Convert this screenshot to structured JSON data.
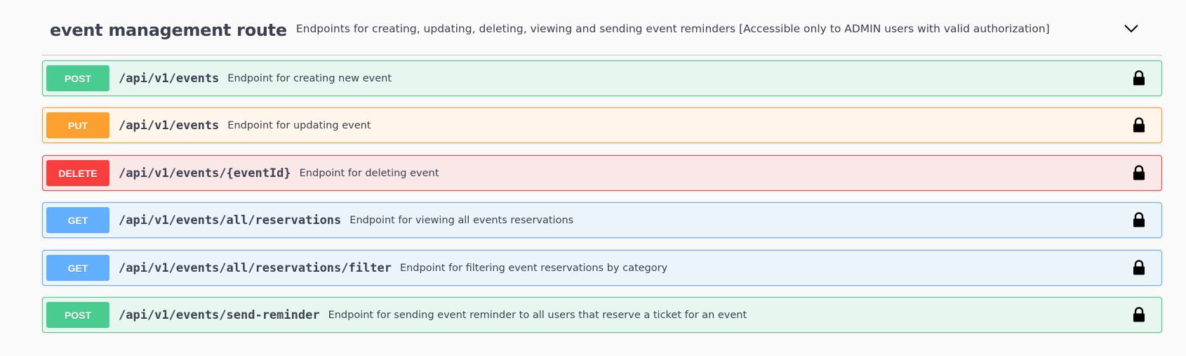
{
  "tag": {
    "name": "event management route",
    "description": "Endpoints for creating, updating, deleting, viewing and sending event reminders [Accessible only to ADMIN users with valid authorization]",
    "toggle_icon": "chevron-down-icon"
  },
  "operations": [
    {
      "method": "POST",
      "path": "/api/v1/events",
      "summary": "Endpoint for creating new event",
      "lock_icon": "lock-icon"
    },
    {
      "method": "PUT",
      "path": "/api/v1/events",
      "summary": "Endpoint for updating event",
      "lock_icon": "lock-icon"
    },
    {
      "method": "DELETE",
      "path": "/api/v1/events/{eventId}",
      "summary": "Endpoint for deleting event",
      "lock_icon": "lock-icon"
    },
    {
      "method": "GET",
      "path": "/api/v1/events/all/reservations",
      "summary": "Endpoint for viewing all events reservations",
      "lock_icon": "lock-icon"
    },
    {
      "method": "GET",
      "path": "/api/v1/events/all/reservations/filter",
      "summary": "Endpoint for filtering event reservations by category",
      "lock_icon": "lock-icon"
    },
    {
      "method": "POST",
      "path": "/api/v1/events/send-reminder",
      "summary": "Endpoint for sending event reminder to all users that reserve a ticket for an event",
      "lock_icon": "lock-icon"
    }
  ],
  "colors": {
    "post": "#49cc90",
    "put": "#fca130",
    "delete": "#f93e3e",
    "get": "#61affe",
    "text": "#3b4151"
  }
}
